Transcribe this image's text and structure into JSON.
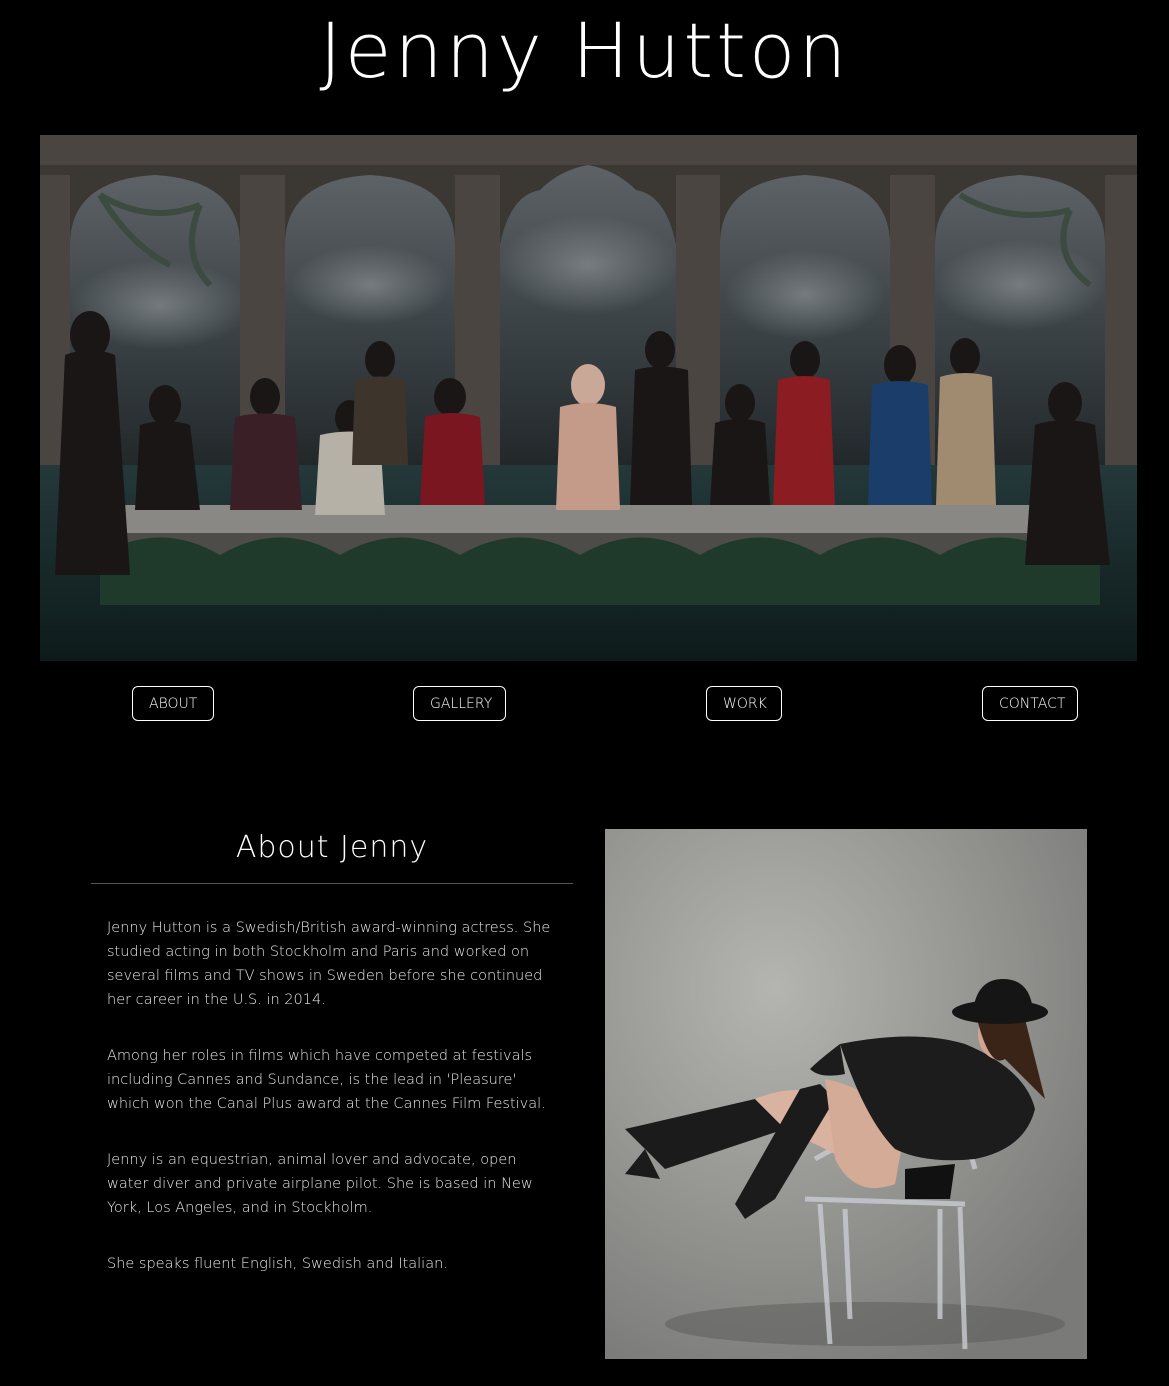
{
  "site": {
    "title": "Jenny Hutton"
  },
  "hero": {
    "image_name": "last-supper-group-photo"
  },
  "nav": {
    "items": [
      {
        "label": "ABOUT"
      },
      {
        "label": "GALLERY"
      },
      {
        "label": "WORK"
      },
      {
        "label": "CONTACT"
      }
    ]
  },
  "about": {
    "heading": "About Jenny",
    "paragraphs": [
      "Jenny Hutton is a Swedish/British award-winning actress. She studied acting in both Stockholm and Paris and worked on several films and TV shows in Sweden before she continued her career in the U.S. in 2014.",
      "Among her roles in films which have competed at festivals including Cannes and Sundance, is the lead in 'Pleasure' which won the Canal Plus award at the Cannes Film Festival.",
      "Jenny is an equestrian, animal lover and advocate, open water diver and private airplane pilot. She is based in New York, Los Angeles, and in Stockholm.",
      "She speaks fluent English, Swedish and Italian."
    ],
    "portrait_name": "portrait-photo"
  },
  "colors": {
    "background": "#000000",
    "text": "#ffffff",
    "rule": "#555555"
  }
}
